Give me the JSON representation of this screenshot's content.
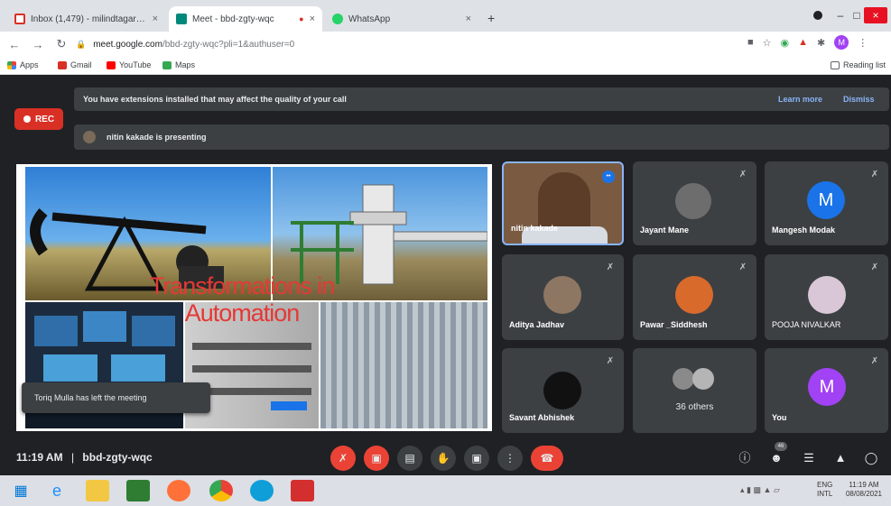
{
  "browser": {
    "tabs": [
      {
        "title": "Inbox (1,479) - milindtagare@(…",
        "close": "×",
        "favicon_color": "#d93025"
      },
      {
        "title": "Meet - bbd-zgty-wqc",
        "close": "×",
        "favicon_color": "#00897b",
        "recording_dot": "●"
      },
      {
        "title": "WhatsApp",
        "close": "×",
        "favicon_color": "#25d366"
      }
    ],
    "new_tab": "+",
    "url_host": "meet.google.com",
    "url_path": "/bbd-zgty-wqc?pli=1&authuser=0",
    "bookmarks": [
      "Apps",
      "Gmail",
      "YouTube",
      "Maps"
    ],
    "reading_list": "Reading list",
    "profile_initial": "M"
  },
  "meet": {
    "banner_text": "You have extensions installed that may affect the quality of your call",
    "learn_more": "Learn more",
    "dismiss": "Dismiss",
    "rec_label": "REC",
    "presenting_text": "nitin kakade is presenting",
    "slide_title_line1": "Transformations in",
    "slide_title_line2": "Automation",
    "toast": "Toriq Mulla has left the meeting",
    "participants": [
      {
        "name": "nitin kakade",
        "type": "video",
        "speaking": true
      },
      {
        "name": "Jayant Mane",
        "type": "photo",
        "color": "#6d6d6d"
      },
      {
        "name": "Mangesh Modak",
        "type": "initial",
        "initial": "M",
        "color": "#1a73e8"
      },
      {
        "name": "Aditya Jadhav",
        "type": "photo",
        "color": "#8d7763"
      },
      {
        "name": "Pawar _Siddhesh",
        "type": "photo",
        "color": "#d86a2c"
      },
      {
        "name": "POOJA NIVALKAR",
        "type": "photo",
        "color": "#d9c7d8"
      },
      {
        "name": "Savant Abhishek",
        "type": "photo",
        "color": "#111111"
      },
      {
        "name": "36 others",
        "type": "group"
      },
      {
        "name": "You",
        "type": "initial",
        "initial": "M",
        "color": "#a142f4"
      }
    ],
    "time": "11:19 AM",
    "separator": "|",
    "meeting_code": "bbd-zgty-wqc",
    "people_count": "46"
  },
  "taskbar": {
    "lang": "ENG",
    "lang2": "INTL",
    "time": "11:19 AM",
    "date": "08/08/2021"
  }
}
